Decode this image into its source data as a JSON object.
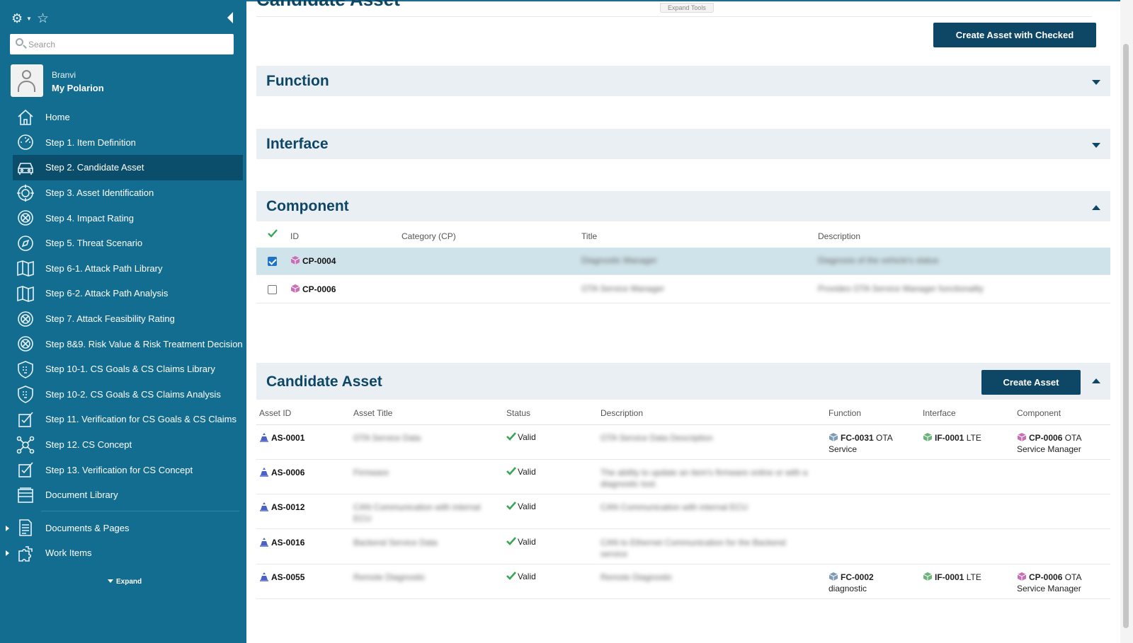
{
  "sidebar": {
    "search_placeholder": "Search",
    "user_name": "Branvi",
    "project_name": "My Polarion",
    "items": [
      {
        "label": "Home",
        "icon": "home-icon"
      },
      {
        "label": "Step 1. Item Definition",
        "icon": "gauge-icon"
      },
      {
        "label": "Step 2. Candidate Asset",
        "icon": "car-icon",
        "active": true
      },
      {
        "label": "Step 3. Asset Identification",
        "icon": "target-icon"
      },
      {
        "label": "Step 4. Impact Rating",
        "icon": "impact-icon"
      },
      {
        "label": "Step 5. Threat Scenario",
        "icon": "compass-icon"
      },
      {
        "label": "Step 6-1. Attack Path Library",
        "icon": "map-icon"
      },
      {
        "label": "Step 6-2. Attack Path Analysis",
        "icon": "map-icon"
      },
      {
        "label": "Step 7. Attack Feasibility Rating",
        "icon": "impact-icon"
      },
      {
        "label": "Step 8&9. Risk Value & Risk Treatment Decision",
        "icon": "impact-icon"
      },
      {
        "label": "Step 10-1. CS Goals & CS Claims Library",
        "icon": "shield-icon"
      },
      {
        "label": "Step 10-2. CS Goals & CS Claims Analysis",
        "icon": "shield-icon"
      },
      {
        "label": "Step 11. Verification for CS Goals & CS Claims",
        "icon": "verify-icon"
      },
      {
        "label": "Step 12. CS Concept",
        "icon": "network-icon"
      },
      {
        "label": "Step 13. Verification for CS Concept",
        "icon": "verify-icon"
      },
      {
        "label": "Document Library",
        "icon": "library-icon"
      }
    ],
    "tree": [
      {
        "label": "Documents & Pages",
        "icon": "document-icon"
      },
      {
        "label": "Work Items",
        "icon": "puzzle-icon"
      }
    ],
    "expand_label": "Expand"
  },
  "main": {
    "page_title": "Candidate Asset",
    "expand_tools": "Expand Tools",
    "create_checked_label": "Create Asset with Checked",
    "sections": {
      "function": "Function",
      "interface": "Interface",
      "component": "Component",
      "candidate": "Candidate Asset"
    },
    "component_table": {
      "headers": [
        "ID",
        "Category (CP)",
        "Title",
        "Description"
      ],
      "rows": [
        {
          "checked": true,
          "id": "CP-0004",
          "title": "Diagnostic Manager",
          "description": "Diagnosis of the vehicle's status"
        },
        {
          "checked": false,
          "id": "CP-0006",
          "title": "OTA Service Manager",
          "description": "Provides OTA Service Manager functionality"
        }
      ]
    },
    "create_asset_label": "Create Asset",
    "asset_table": {
      "headers": [
        "Asset ID",
        "Asset Title",
        "Status",
        "Description",
        "Function",
        "Interface",
        "Component"
      ],
      "rows": [
        {
          "id": "AS-0001",
          "title": "OTA Service Data",
          "status": "Valid",
          "description": "OTA Service Data Description",
          "fn_id": "FC-0031",
          "fn_text": "OTA Service",
          "if_id": "IF-0001",
          "if_text": "LTE",
          "cp_id": "CP-0006",
          "cp_text": "OTA Service Manager"
        },
        {
          "id": "AS-0006",
          "title": "Firmware",
          "status": "Valid",
          "description": "The ability to update an item's firmware online or with a diagnostic tool.",
          "fn_id": "",
          "fn_text": "",
          "if_id": "",
          "if_text": "",
          "cp_id": "",
          "cp_text": ""
        },
        {
          "id": "AS-0012",
          "title": "CAN Communication with internal ECU",
          "status": "Valid",
          "description": "CAN Communication with internal ECU",
          "fn_id": "",
          "fn_text": "",
          "if_id": "",
          "if_text": "",
          "cp_id": "",
          "cp_text": ""
        },
        {
          "id": "AS-0016",
          "title": "Backend Service Data",
          "status": "Valid",
          "description": "CAN to Ethernet Communication for the Backend service",
          "fn_id": "",
          "fn_text": "",
          "if_id": "",
          "if_text": "",
          "cp_id": "",
          "cp_text": ""
        },
        {
          "id": "AS-0055",
          "title": "Remote Diagnostic",
          "status": "Valid",
          "description": "Remote Diagnostic",
          "fn_id": "FC-0002",
          "fn_text": "diagnostic",
          "if_id": "IF-0001",
          "if_text": "LTE",
          "cp_id": "CP-0006",
          "cp_text": "OTA Service Manager"
        }
      ]
    }
  },
  "colors": {
    "sidebar_bg": "#136d90",
    "sidebar_active": "#0b4e6c",
    "primary": "#0e4766",
    "section_bg": "#eaeff3",
    "selected_row": "#cfe3ea",
    "valid_green": "#3aa655"
  }
}
